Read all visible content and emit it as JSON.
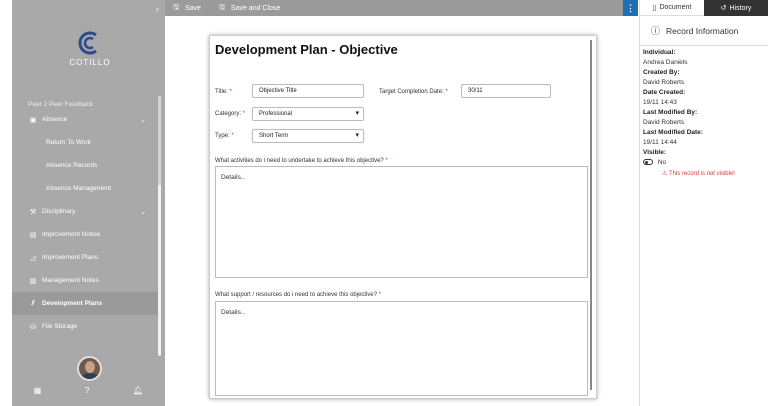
{
  "toolbar": {
    "save_label": "Save",
    "save_close_label": "Save and Close",
    "info_label": "⋮"
  },
  "sidebar": {
    "logo_text": "COTILLO",
    "items": [
      {
        "label": "Peer 2 Peer Feedback",
        "icon": "feedback-icon"
      },
      {
        "label": "Absence",
        "icon": "briefcase-icon"
      },
      {
        "label": "Return To Work",
        "icon": ""
      },
      {
        "label": "Absence Records",
        "icon": ""
      },
      {
        "label": "Absence Management",
        "icon": ""
      },
      {
        "label": "Disciplinary",
        "icon": "gavel-icon"
      },
      {
        "label": "Improvement Notice",
        "icon": "document-icon"
      },
      {
        "label": "Improvement Plans",
        "icon": "chart-icon"
      },
      {
        "label": "Management Notes",
        "icon": "notes-icon"
      },
      {
        "label": "Development Plans",
        "icon": "growth-icon"
      },
      {
        "label": "File Storage",
        "icon": "storage-icon"
      }
    ]
  },
  "document": {
    "title": "Development Plan - Objective",
    "title_label": "Title:",
    "title_value": "Objective Title",
    "target_label": "Target Completion Date:",
    "target_value": "30/11",
    "category_label": "Category:",
    "category_value": "Professional",
    "type_label": "Type:",
    "type_value": "Short Term",
    "q1_label": "What activities do i need to undertake to achieve this objective?",
    "q1_value": "Details..",
    "q2_label": "What support / resources do i need to achieve this objective?",
    "q2_value": "Details..",
    "required_mark": "*"
  },
  "panel": {
    "tab_document": "Document",
    "tab_history": "History",
    "heading": "Record Information",
    "individual_label": "Individual:",
    "individual_value": "Andrea Daniels",
    "created_by_label": "Created By:",
    "created_by_value": "David Roberts",
    "date_created_label": "Date Created:",
    "date_created_value": "19/11 14:43",
    "modified_by_label": "Last Modified By:",
    "modified_by_value": "David Roberts",
    "modified_date_label": "Last Modified Date:",
    "modified_date_value": "19/11 14:44",
    "visible_label": "Visible:",
    "visible_value": "No",
    "warning": "This record is not visible!"
  },
  "colors": {
    "sidebar_bg": "#a9a9a9",
    "toolbar_bg": "#9b9b9b",
    "accent": "#1f6fb5",
    "warning": "#d83b3b",
    "logo_blue": "#2c4a8c"
  }
}
